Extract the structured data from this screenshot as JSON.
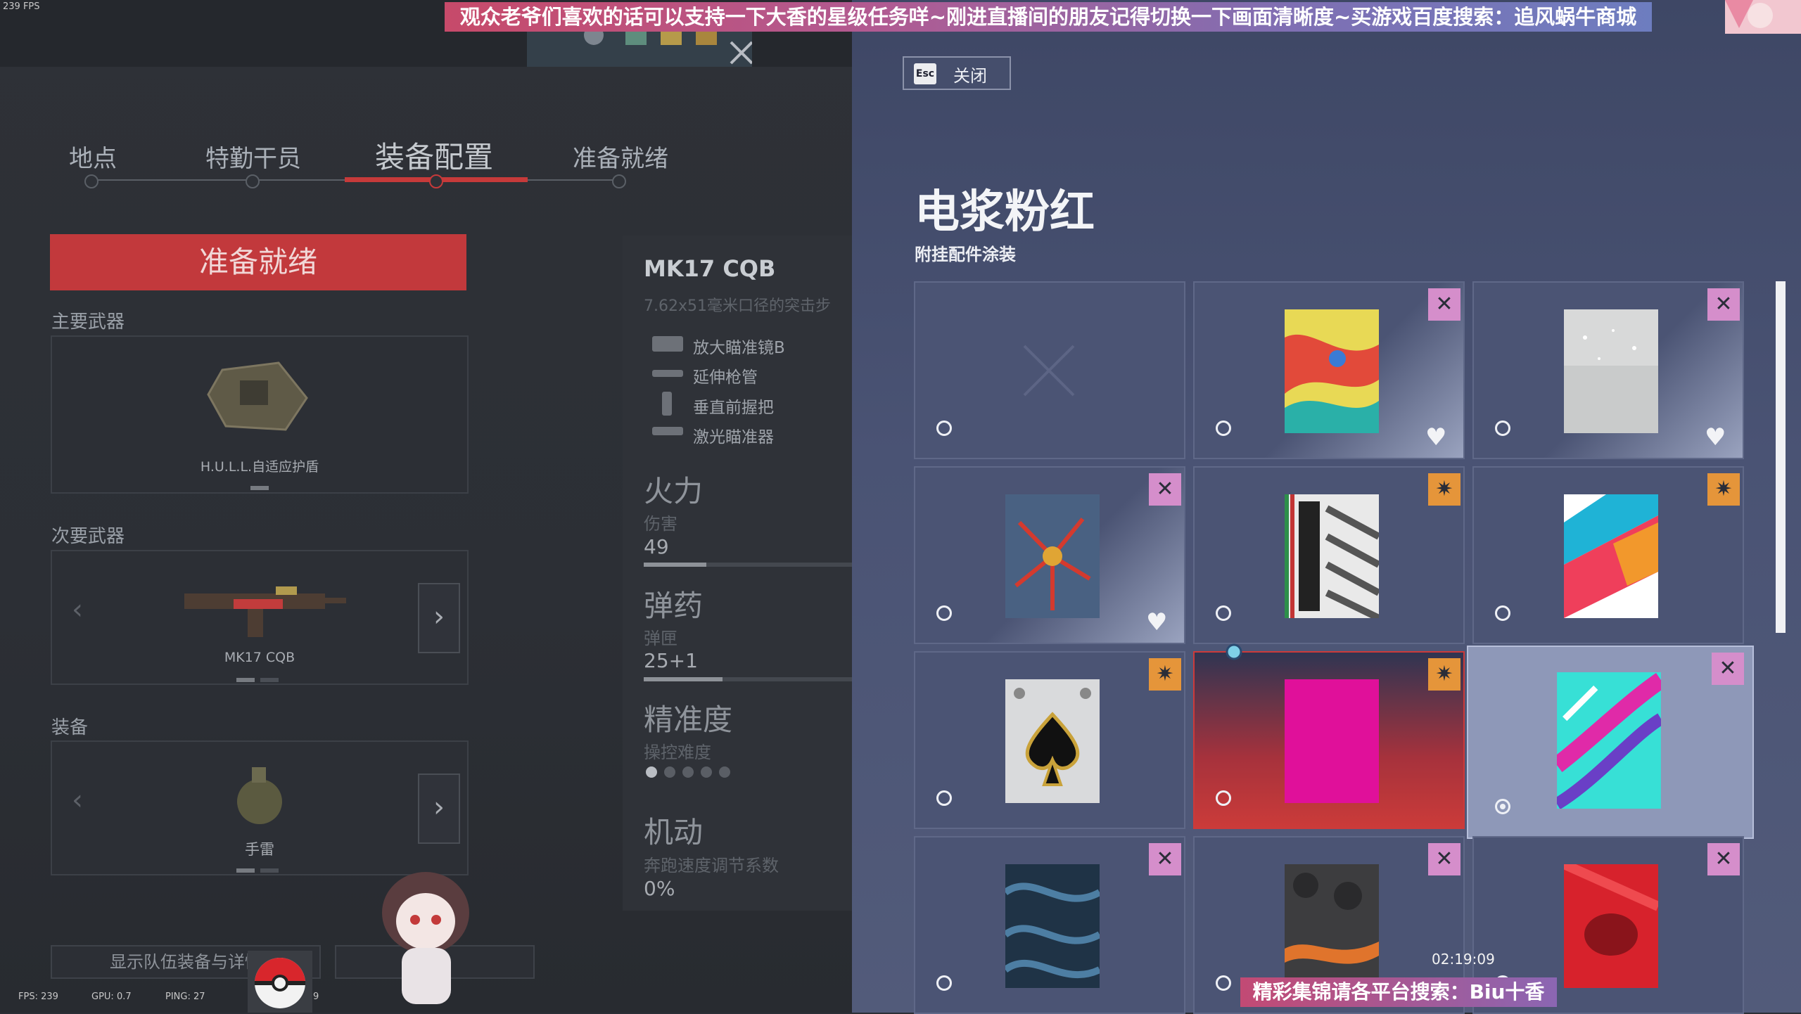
{
  "overlay": {
    "fps_corner": "239 FPS",
    "top_banner": "观众老爷们喜欢的话可以支持一下大香的星级任务咩~刚进直播间的朋友记得切换一下画面清晰度~买游戏百度搜索：追风蜗牛商城",
    "bottom_banner": "精彩集锦请各平台搜索：Biu十香",
    "timer": "02:19:09",
    "perf_fps": "FPS: 239",
    "perf_gpu": "GPU: 0.7",
    "perf_ping": "PING: 27",
    "perf_extra": "9"
  },
  "nav": {
    "tabs": [
      {
        "label": "地点"
      },
      {
        "label": "特勤干员"
      },
      {
        "label": "装备配置"
      },
      {
        "label": "准备就绪"
      }
    ],
    "active_index": 2
  },
  "loadout": {
    "ready_label": "准备就绪",
    "primary_label": "主要武器",
    "primary_item": "H.U.L.L.自适应护盾",
    "secondary_label": "次要武器",
    "secondary_item": "MK17 CQB",
    "equipment_label": "装备",
    "equipment_item": "手雷",
    "show_team_label": "显示队伍装备与详情"
  },
  "weapon": {
    "name": "MK17 CQB",
    "subtitle": "7.62x51毫米口径的突击步",
    "attachments": [
      "放大瞄准镜B",
      "延伸枪管",
      "垂直前握把",
      "激光瞄准器"
    ],
    "firepower_label": "火力",
    "damage_label": "伤害",
    "damage_value": "49",
    "damage_fraction": 0.3,
    "ammo_label": "弹药",
    "mag_label": "弹匣",
    "mag_value": "25+1",
    "mag_fraction": 0.38,
    "accuracy_label": "精准度",
    "handling_label": "操控难度",
    "handling_level": 1,
    "handling_max": 5,
    "mobility_label": "机动",
    "mobility_sub": "奔跑速度调节系数",
    "mobility_value": "0%"
  },
  "skins": {
    "close_key": "Esc",
    "close_label": "关闭",
    "title": "电浆粉红",
    "subtitle": "附挂配件涂装",
    "colors": {
      "x_badge": "#d58ecb",
      "star_badge": "#e5953a",
      "active": "#cb3b39"
    }
  }
}
